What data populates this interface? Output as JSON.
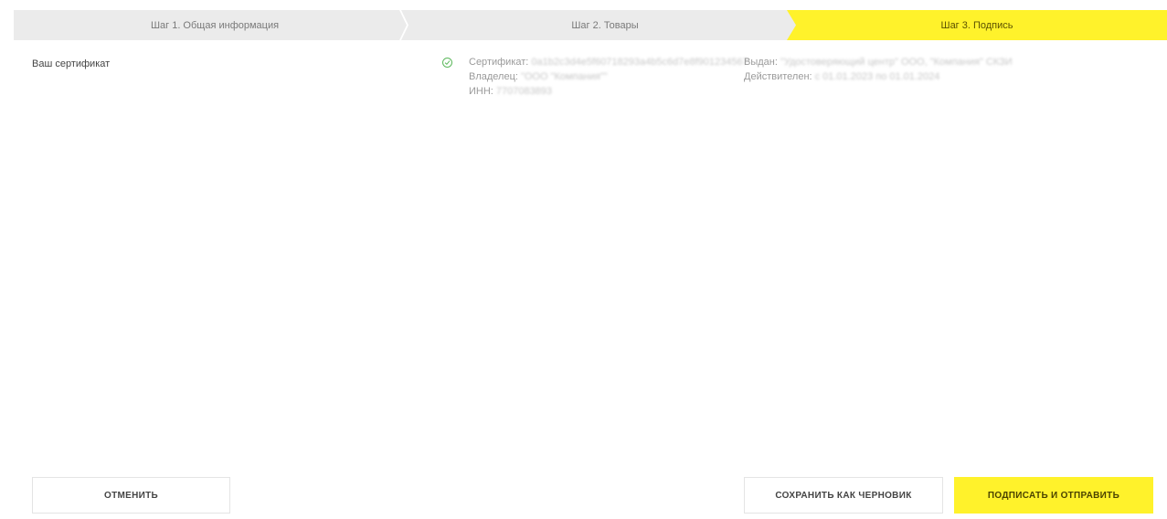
{
  "stepper": {
    "steps": [
      {
        "label": "Шаг 1. Общая информация",
        "state": "done"
      },
      {
        "label": "Шаг 2. Товары",
        "state": "done"
      },
      {
        "label": "Шаг 3. Подпись",
        "state": "active"
      }
    ],
    "active_color": "#fff22b",
    "inactive_color": "#ebebeb"
  },
  "certificate": {
    "section_label": "Ваш сертификат",
    "status_icon": "check-circle-icon",
    "status_color": "#5cb85c",
    "certificate_label": "Сертификат:",
    "certificate_value": "0a1b2c3d4e5f60718293a4b5c6d7e8f901234567",
    "owner_label": "Владелец:",
    "owner_value": "\"ООО \"Компания\"\"",
    "inn_label": "ИНН:",
    "inn_value": "7707083893",
    "issuer_label": "Выдан:",
    "issuer_value": "\"Удостоверяющий центр\" ООО, \"Компания\" СКЗИ",
    "valid_label": "Действителен:",
    "valid_value": "с 01.01.2023 по 01.01.2024"
  },
  "actions": {
    "cancel_label": "ОТМЕНИТЬ",
    "save_draft_label": "СОХРАНИТЬ КАК ЧЕРНОВИК",
    "sign_send_label": "ПОДПИСАТЬ И ОТПРАВИТЬ"
  }
}
